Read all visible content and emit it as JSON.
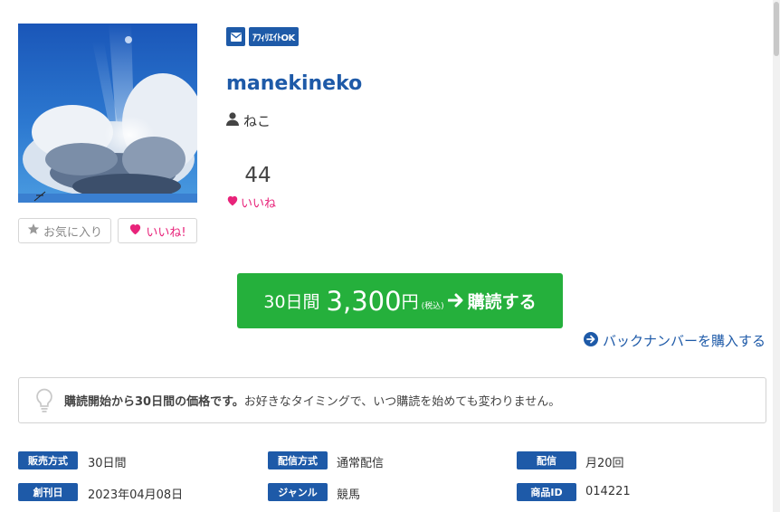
{
  "badges": {
    "mail_icon": "envelope-icon",
    "affiliate": "ｱﾌｨﾘｴｲﾄOK"
  },
  "magazine": {
    "title": "manekineko",
    "author": "ねこ"
  },
  "likes": {
    "count": "44",
    "label": "いいね"
  },
  "actions": {
    "favorite": "お気に入り",
    "like": "いいね!"
  },
  "purchase": {
    "period": "30日間",
    "price": "3,300",
    "yen": "円",
    "tax": "(税込)",
    "action": "購読する",
    "backnumber": "バックナンバーを購入する"
  },
  "notice": {
    "bold": "購読開始から30日間の価格です。",
    "text": "お好きなタイミングで、いつ購読を始めても変わりません。"
  },
  "meta": {
    "sales_method": {
      "label": "販売方式",
      "value": "30日間"
    },
    "delivery_method": {
      "label": "配信方式",
      "value": "通常配信"
    },
    "delivery": {
      "label": "配信",
      "value": "月20回"
    },
    "founded": {
      "label": "創刊日",
      "value": "2023年04月08日"
    },
    "genre": {
      "label": "ジャンル",
      "value": "競馬"
    },
    "product_id": {
      "label": "商品ID",
      "value": "014221"
    }
  },
  "colors": {
    "brand": "#1e5aa8",
    "buy": "#25b03c",
    "like": "#e8237a"
  }
}
